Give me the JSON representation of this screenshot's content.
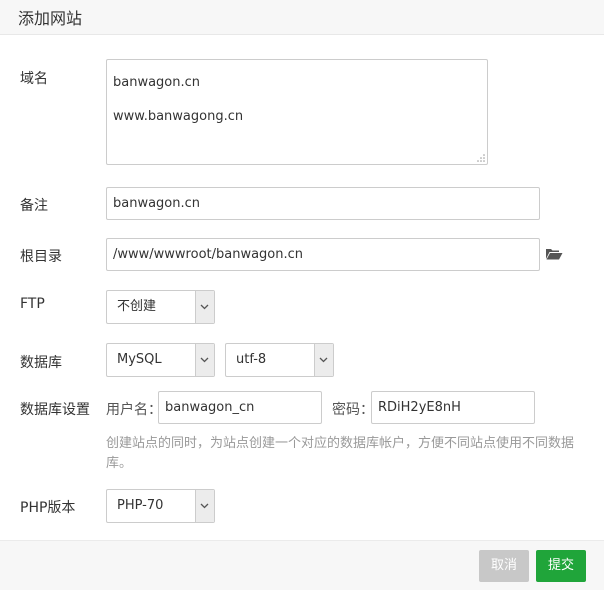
{
  "dialog": {
    "title": "添加网站"
  },
  "fields": {
    "domain": {
      "label": "域名",
      "lines": [
        "banwagon.cn",
        "www.banwagong.cn"
      ]
    },
    "remark": {
      "label": "备注",
      "value": "banwagon.cn"
    },
    "root": {
      "label": "根目录",
      "value": "/www/wwwroot/banwagon.cn"
    },
    "ftp": {
      "label": "FTP",
      "selected": "不创建"
    },
    "database": {
      "label": "数据库",
      "type_selected": "MySQL",
      "charset_selected": "utf-8"
    },
    "db_settings": {
      "label": "数据库设置",
      "username_label": "用户名：",
      "username_value": "banwagon_cn",
      "password_label": "密码：",
      "password_value": "RDiH2yE8nH",
      "hint": "创建站点的同时，为站点创建一个对应的数据库帐户，方便不同站点使用不同数据库。"
    },
    "php": {
      "label": "PHP版本",
      "selected": "PHP-70"
    }
  },
  "footer": {
    "cancel_label": "取消",
    "submit_label": "提交"
  },
  "icons": {
    "folder": "folder-open-icon",
    "select_arrow": "chevron-down-icon",
    "resize": "resize-grip-icon"
  },
  "colors": {
    "submit": "#20a53a",
    "cancel": "#c8c8c8"
  }
}
